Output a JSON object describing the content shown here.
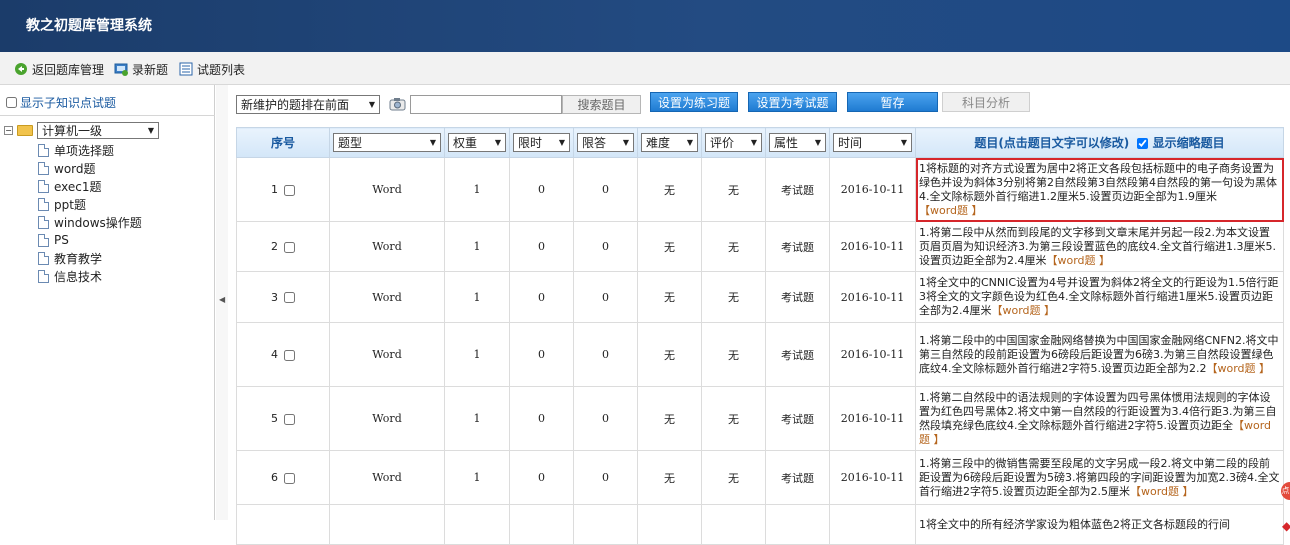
{
  "app": {
    "title": "教之初题库管理系统"
  },
  "toolbar": {
    "back_label": "返回题库管理",
    "new_label": "录新题",
    "list_label": "试题列表"
  },
  "sidebar": {
    "show_sub_label": "显示子知识点试题",
    "root_value": "计算机一级",
    "children": [
      "单项选择题",
      "word题",
      "exec1题",
      "ppt题",
      "windows操作题",
      "PS",
      "教育教学",
      "信息技术"
    ]
  },
  "filters": {
    "sort_value": "新维护的题排在前面",
    "search_placeholder": "",
    "search_button": "搜索题目",
    "practice_button": "设置为练习题",
    "exam_button": "设置为考试题",
    "pause_button": "暂存",
    "analysis_button": "科目分析"
  },
  "table": {
    "headers": {
      "index": "序号",
      "type": "题型",
      "weight": "权重",
      "time_limit": "限时",
      "answer_limit": "限答",
      "difficulty": "难度",
      "rating": "评价",
      "attribute": "属性",
      "time": "时间",
      "question": "题目(点击题目文字可以修改)",
      "show_abbrev": "显示缩略题目"
    },
    "rows": [
      {
        "index": "1",
        "type": "Word",
        "weight": "1",
        "time_limit": "0",
        "answer_limit": "0",
        "difficulty": "无",
        "rating": "无",
        "attribute": "考试题",
        "time": "2016-10-11",
        "text": "1将标题的对齐方式设置为居中2将正文各段包括标题中的电子商务设置为绿色并设为斜体3分别将第2自然段第3自然段第4自然段的第一句设为黑体4.全文除标题外首行缩进1.2厘米5.设置页边距全部为1.9厘米",
        "tag": "【word题 】"
      },
      {
        "index": "2",
        "type": "Word",
        "weight": "1",
        "time_limit": "0",
        "answer_limit": "0",
        "difficulty": "无",
        "rating": "无",
        "attribute": "考试题",
        "time": "2016-10-11",
        "text": "1.将第二段中从然而到段尾的文字移到文章末尾并另起一段2.为本文设置页眉页眉为知识经济3.为第三段设置蓝色的底纹4.全文首行缩进1.3厘米5.设置页边距全部为2.4厘米",
        "tag": "【word题 】"
      },
      {
        "index": "3",
        "type": "Word",
        "weight": "1",
        "time_limit": "0",
        "answer_limit": "0",
        "difficulty": "无",
        "rating": "无",
        "attribute": "考试题",
        "time": "2016-10-11",
        "text": "1将全文中的CNNIC设置为4号并设置为斜体2将全文的行距设为1.5倍行距3将全文的文字颜色设为红色4.全文除标题外首行缩进1厘米5.设置页边距全部为2.4厘米",
        "tag": "【word题 】"
      },
      {
        "index": "4",
        "type": "Word",
        "weight": "1",
        "time_limit": "0",
        "answer_limit": "0",
        "difficulty": "无",
        "rating": "无",
        "attribute": "考试题",
        "time": "2016-10-11",
        "text": "1.将第二段中的中国国家金融网络替换为中国国家金融网络CNFN2.将文中第三自然段的段前距设置为6磅段后距设置为6磅3.为第三自然段设置绿色底纹4.全文除标题外首行缩进2字符5.设置页边距全部为2.2",
        "tag": "【word题 】"
      },
      {
        "index": "5",
        "type": "Word",
        "weight": "1",
        "time_limit": "0",
        "answer_limit": "0",
        "difficulty": "无",
        "rating": "无",
        "attribute": "考试题",
        "time": "2016-10-11",
        "text": "1.将第二自然段中的语法规则的字体设置为四号黑体惯用法规则的字体设置为红色四号黑体2.将文中第一自然段的行距设置为3.4倍行距3.为第三自然段填充绿色底纹4.全文除标题外首行缩进2字符5.设置页边距全",
        "tag": "【word题 】"
      },
      {
        "index": "6",
        "type": "Word",
        "weight": "1",
        "time_limit": "0",
        "answer_limit": "0",
        "difficulty": "无",
        "rating": "无",
        "attribute": "考试题",
        "time": "2016-10-11",
        "text": "1.将第三段中的微销售需要至段尾的文字另成一段2.将文中第二段的段前距设置为6磅段后距设置为5磅3.将第四段的字间距设置为加宽2.3磅4.全文首行缩进2字符5.设置页边距全部为2.5厘米",
        "tag": "【word题 】"
      },
      {
        "index": "",
        "type": "",
        "weight": "",
        "time_limit": "",
        "answer_limit": "",
        "difficulty": "",
        "rating": "",
        "attribute": "",
        "time": "",
        "text": "1将全文中的所有经济学家设为粗体蓝色2将正文各标题段的行间",
        "tag": ""
      }
    ]
  },
  "colors": {
    "header_bg": "#1b3c6a",
    "button_blue": "#1f7bd1",
    "highlight_red": "#d6262b",
    "tag_color": "#b5651d"
  }
}
